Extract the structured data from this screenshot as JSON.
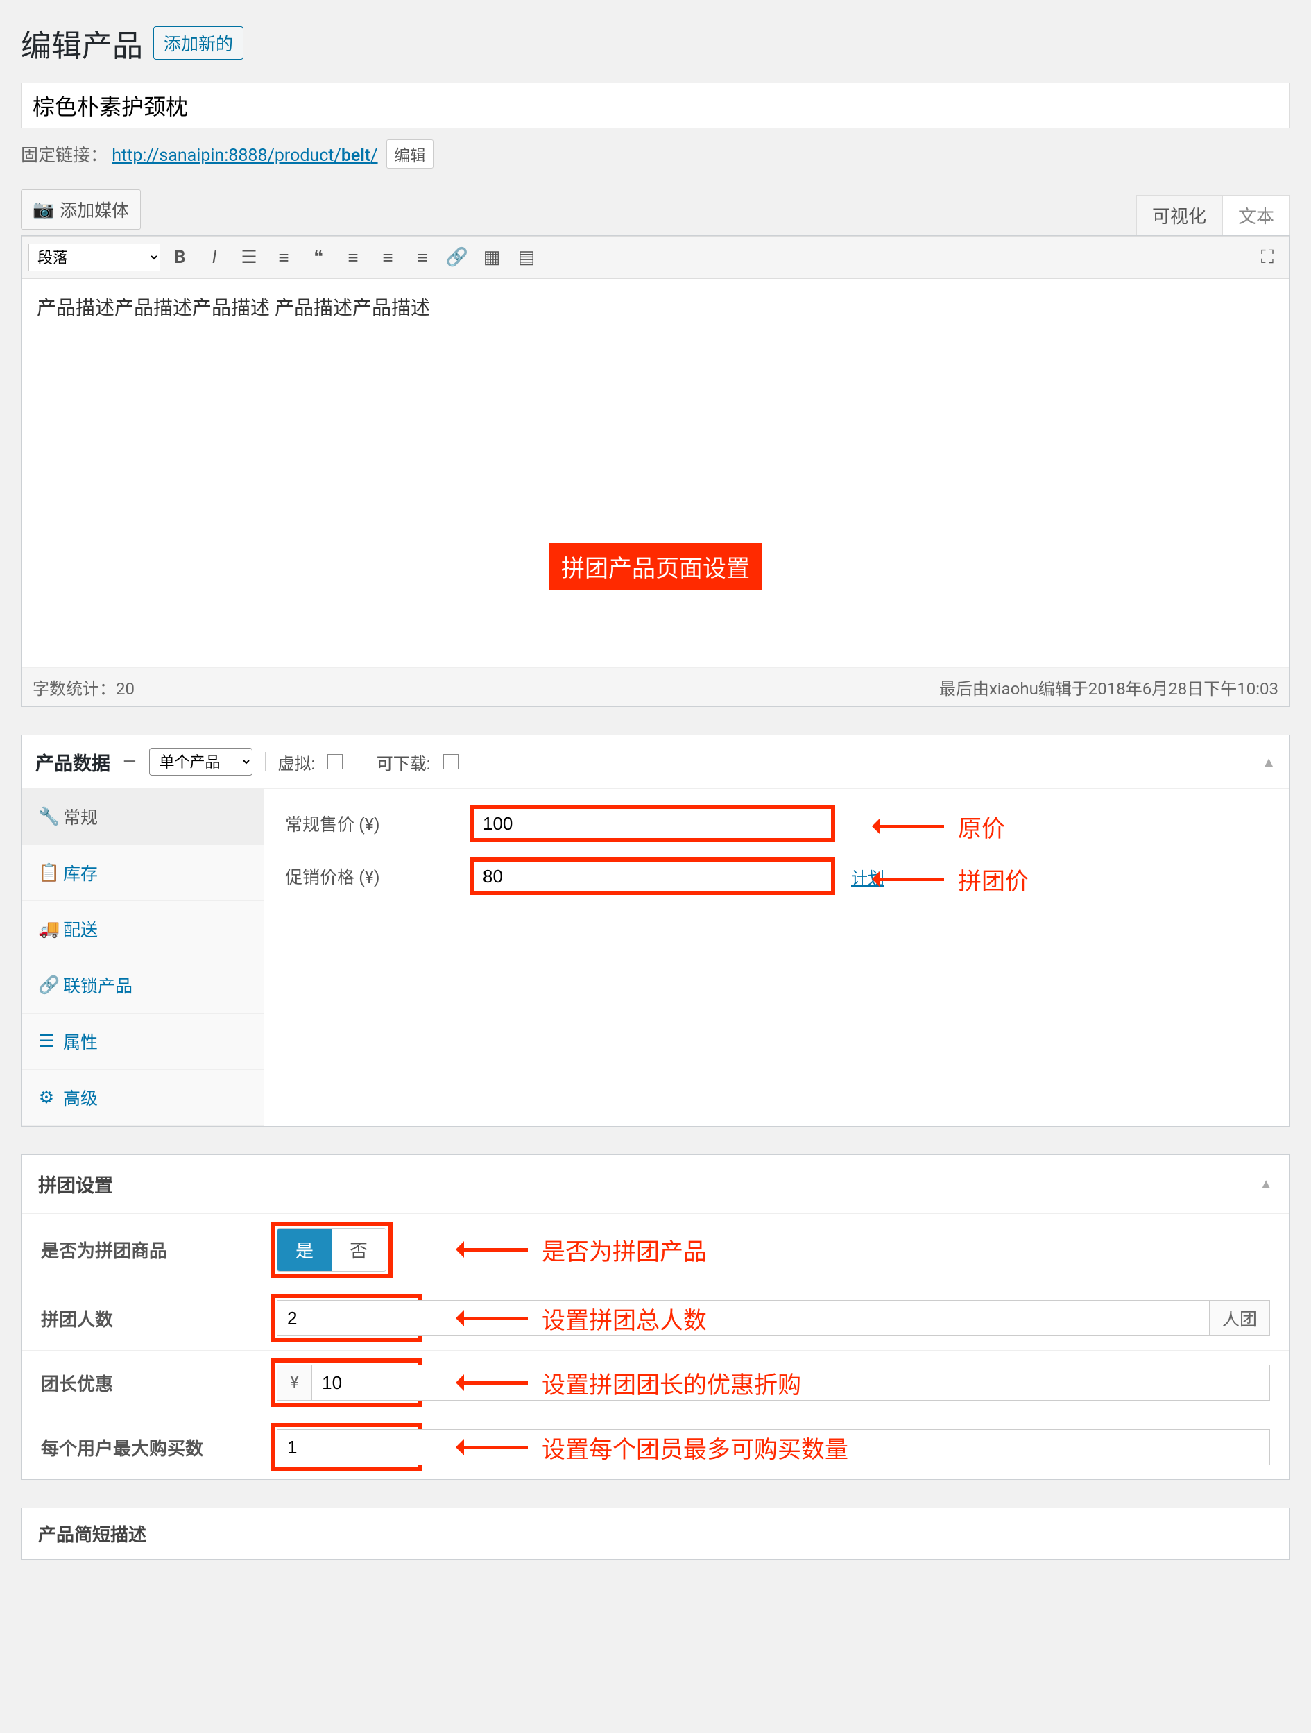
{
  "header": {
    "title": "编辑产品",
    "add_new": "添加新的"
  },
  "title_input": "棕色朴素护颈枕",
  "permalink": {
    "label": "固定链接：",
    "base": "http://sanaipin:8888/product/",
    "slug": "belt",
    "slash": "/",
    "edit": "编辑"
  },
  "editor": {
    "add_media": "添加媒体",
    "tabs": {
      "visual": "可视化",
      "text": "文本"
    },
    "format": "段落",
    "content": "产品描述产品描述产品描述 产品描述产品描述",
    "annotation": "拼团产品页面设置",
    "wordcount_label": "字数统计：",
    "wordcount": "20",
    "last_edited": "最后由xiaohu编辑于2018年6月28日下午10:03"
  },
  "product_data": {
    "title": "产品数据",
    "dash": "—",
    "type": "单个产品",
    "virtual_label": "虚拟:",
    "downloadable_label": "可下载:"
  },
  "pd_tabs": {
    "general": "常规",
    "inventory": "库存",
    "shipping": "配送",
    "linked": "联锁产品",
    "attributes": "属性",
    "advanced": "高级"
  },
  "price": {
    "regular_label": "常规售价 (¥)",
    "regular_value": "100",
    "sale_label": "促销价格 (¥)",
    "sale_value": "80",
    "schedule": "计划",
    "annot_regular": "原价",
    "annot_sale": "拼团价"
  },
  "groupbuy": {
    "title": "拼团设置",
    "is_group_label": "是否为拼团商品",
    "yes": "是",
    "no": "否",
    "annot_is_group": "是否为拼团产品",
    "people_label": "拼团人数",
    "people_value": "2",
    "people_suffix": "人团",
    "annot_people": "设置拼团总人数",
    "leader_label": "团长优惠",
    "leader_prefix": "¥",
    "leader_value": "10",
    "annot_leader": "设置拼团团长的优惠折购",
    "max_label": "每个用户最大购买数",
    "max_value": "1",
    "annot_max": "设置每个团员最多可购买数量"
  },
  "bottom": {
    "label": "产品简短描述"
  }
}
